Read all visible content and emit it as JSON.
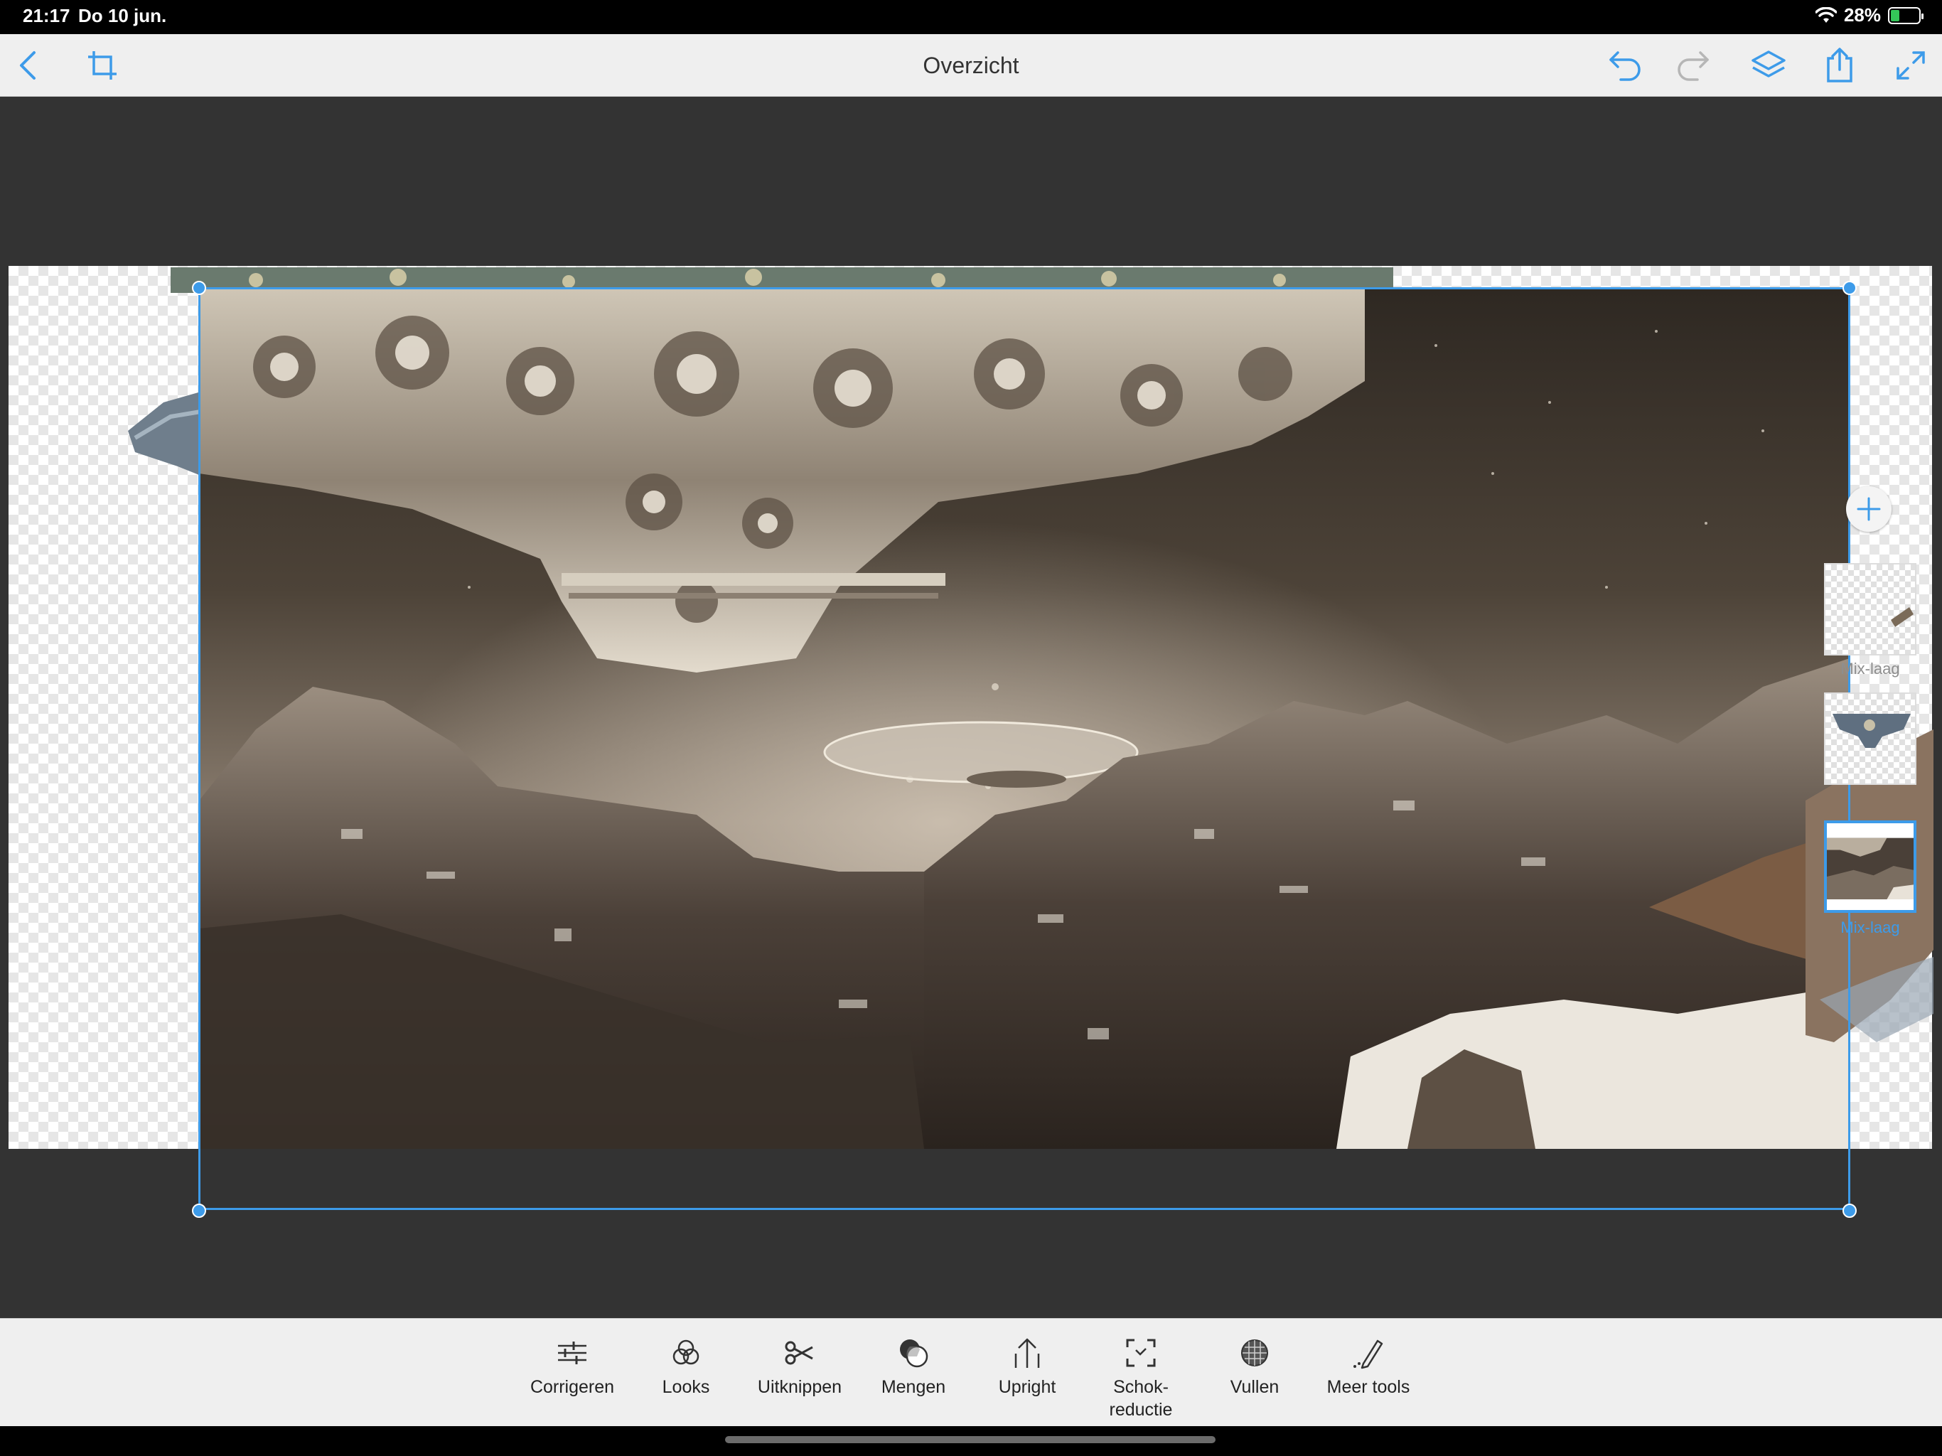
{
  "status": {
    "time": "21:17",
    "date": "Do 10 jun.",
    "battery_percent": "28%",
    "battery_level": 0.28
  },
  "header": {
    "title": "Overzicht",
    "icons": [
      "back-chevron-icon",
      "crop-icon",
      "undo-icon",
      "redo-icon",
      "layers-icon",
      "share-icon",
      "fullscreen-icon"
    ]
  },
  "layers": {
    "add_icon": "plus-icon",
    "items": [
      {
        "label": "Mix-laag",
        "active": false
      },
      {
        "label": "",
        "active": false
      },
      {
        "label": "Mix-laag",
        "active": true
      }
    ]
  },
  "tools": [
    {
      "label": "Corrigeren",
      "icon": "sliders-icon"
    },
    {
      "label": "Looks",
      "icon": "looks-icon"
    },
    {
      "label": "Uitknippen",
      "icon": "scissors-icon"
    },
    {
      "label": "Mengen",
      "icon": "blend-icon"
    },
    {
      "label": "Upright",
      "icon": "upright-icon"
    },
    {
      "label": "Schok-",
      "label2": "reductie",
      "icon": "shake-reduction-icon"
    },
    {
      "label": "Vullen",
      "icon": "fill-icon"
    },
    {
      "label": "Meer tools",
      "icon": "more-tools-icon"
    }
  ],
  "colors": {
    "accent": "#3d9be9",
    "canvas_bg": "#333333",
    "toolbar_bg": "#efefef",
    "battery_green": "#34c759"
  }
}
